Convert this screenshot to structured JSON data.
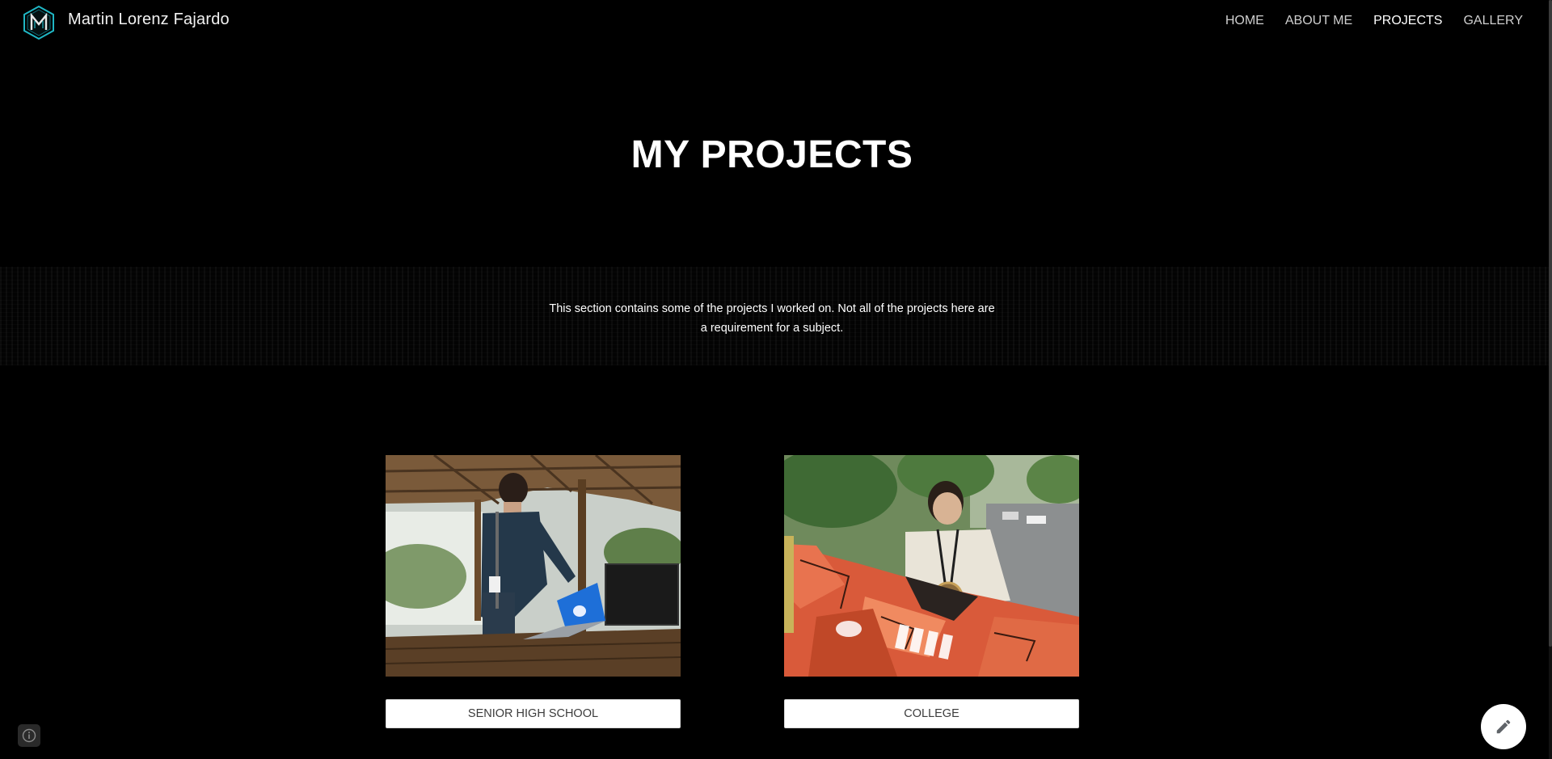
{
  "header": {
    "site_title": "Martin Lorenz Fajardo",
    "logo_icon": "monogram-m-logo-icon",
    "nav": [
      {
        "label": "HOME",
        "active": false
      },
      {
        "label": "ABOUT ME",
        "active": false
      },
      {
        "label": "PROJECTS",
        "active": true
      },
      {
        "label": "GALLERY",
        "active": false
      }
    ]
  },
  "hero": {
    "title": "MY PROJECTS"
  },
  "intro": {
    "line1": "This section contains some of the projects I worked on. Not all of the projects here are",
    "line2": "a requirement for a subject."
  },
  "projects": [
    {
      "button_label": "SENIOR HIGH SCHOOL",
      "photo": "student-with-laptop-photo"
    },
    {
      "button_label": "COLLEGE",
      "photo": "student-holding-cyber-team-flag-photo"
    }
  ],
  "controls": {
    "edit_icon": "pencil-icon",
    "info_icon": "info-icon"
  },
  "colors": {
    "background": "#000000",
    "text": "#ffffff",
    "nav_inactive": "#cfcfcf",
    "button_bg": "#ffffff",
    "button_text": "#3c3c3c",
    "logo_accent": "#1fb6c4"
  }
}
